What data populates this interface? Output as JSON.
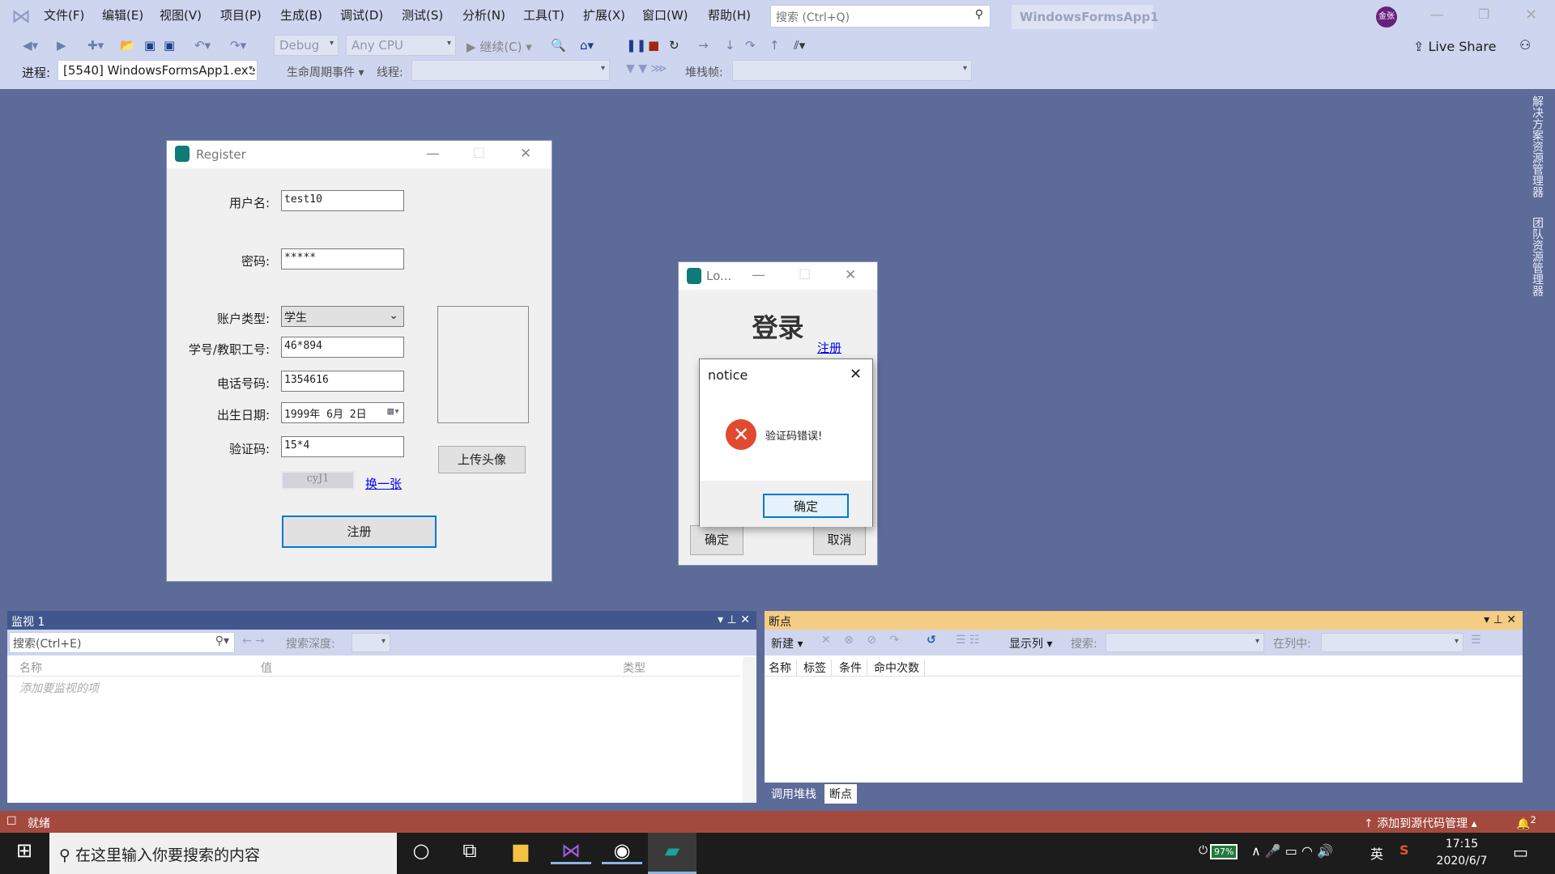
{
  "ide": {
    "menu": [
      "文件(F)",
      "编辑(E)",
      "视图(V)",
      "项目(P)",
      "生成(B)",
      "调试(D)",
      "测试(S)",
      "分析(N)",
      "工具(T)",
      "扩展(X)",
      "窗口(W)",
      "帮助(H)"
    ],
    "search_placeholder": "搜索 (Ctrl+Q)",
    "solution_name": "WindowsFormsApp1",
    "avatar": "金张",
    "live_share": "Live Share",
    "config": "Debug",
    "platform": "Any CPU",
    "continue": "继续(C)",
    "process_label": "进程:",
    "process_value": "[5540] WindowsFormsApp1.exe",
    "lifecycle": "生命周期事件",
    "thread_label": "线程:",
    "stack_label": "堆栈帧:",
    "side_tabs": [
      "解决方案资源管理器",
      "团队资源管理器"
    ]
  },
  "register": {
    "title": "Register",
    "fields": [
      {
        "label": "用户名:",
        "value": "test10"
      },
      {
        "label": "密码:",
        "value": "*****"
      },
      {
        "label": "账户类型:",
        "value": "学生"
      },
      {
        "label": "学号/教职工号:",
        "value": "46*894"
      },
      {
        "label": "电话号码:",
        "value": "1354616"
      },
      {
        "label": "出生日期:",
        "value": "1999年 6月 2日"
      },
      {
        "label": "验证码:",
        "value": "15*4"
      }
    ],
    "captcha": "cyJ1",
    "refresh_link": "换一张",
    "upload_button": "上传头像",
    "submit_button": "注册"
  },
  "login": {
    "title": "Lo...",
    "heading": "登录",
    "register_link": "注册",
    "ok": "确定",
    "cancel": "取消"
  },
  "notice": {
    "title": "notice",
    "message": "验证码错误!",
    "ok": "确定",
    "icon_color": "#e04a2f"
  },
  "watch": {
    "title": "监视 1",
    "search_placeholder": "搜索(Ctrl+E)",
    "depth_label": "搜索深度:",
    "columns": [
      "名称",
      "值",
      "类型"
    ],
    "placeholder_row": "添加要监视的项"
  },
  "breakpoints": {
    "title": "断点",
    "new": "新建",
    "show_columns": "显示列",
    "search_label": "搜索:",
    "in_column_label": "在列中:",
    "columns": [
      "名称",
      "标签",
      "条件",
      "命中次数"
    ],
    "tabs": [
      "调用堆栈",
      "断点"
    ]
  },
  "status": {
    "text": "就绪",
    "source_control": "添加到源代码管理",
    "notifications": "2"
  },
  "taskbar": {
    "search_placeholder": "在这里输入你要搜索的内容",
    "battery": "97%",
    "ime": "英",
    "time": "17:15",
    "date": "2020/6/7"
  }
}
